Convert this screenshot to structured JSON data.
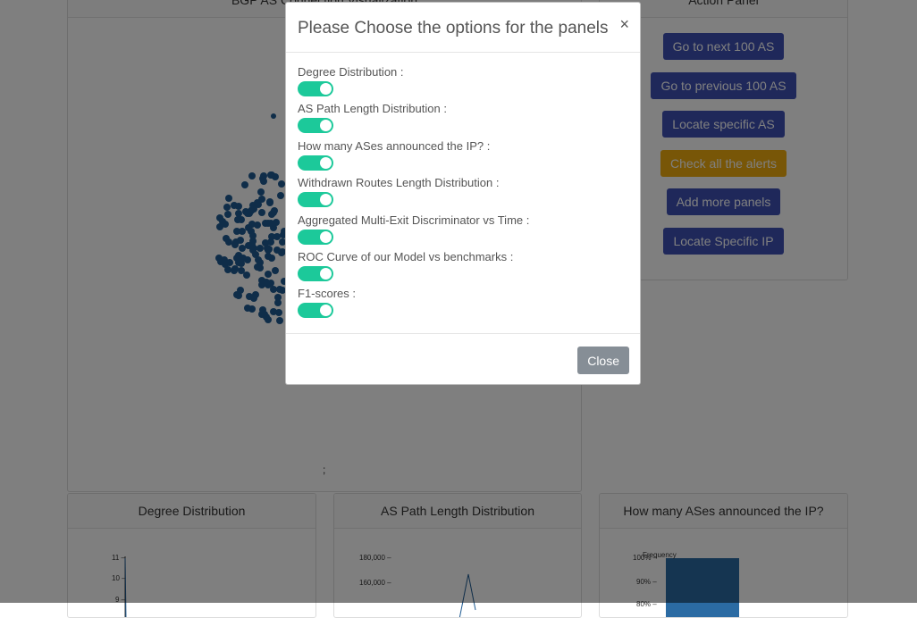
{
  "top_panel": {
    "title": "BGP AS Connection Visualization",
    "footnote": ";"
  },
  "action_panel": {
    "title": "Action Panel",
    "buttons": [
      {
        "label": "Go to next 100 AS"
      },
      {
        "label": "Go to previous 100 AS"
      },
      {
        "label": "Locate specific AS"
      },
      {
        "label": "Check all the alerts"
      },
      {
        "label": "Add more panels"
      },
      {
        "label": "Locate Specific IP"
      }
    ]
  },
  "bottom_panels": {
    "degree": {
      "title": "Degree Distribution",
      "y_ticks": [
        "11 –",
        "10 –",
        "9 –"
      ]
    },
    "path_length": {
      "title": "AS Path Length Distribution",
      "y_ticks": [
        "180,000 –",
        "160,000 –"
      ]
    },
    "announced": {
      "title": "How many ASes announced the IP?",
      "legend": "Frequency",
      "y_ticks": [
        "100% –",
        "90% –",
        "80% –"
      ]
    }
  },
  "modal": {
    "title": "Please Choose the options for the panels",
    "close_symbol": "×",
    "options": [
      {
        "label": "Degree Distribution :",
        "enabled": true
      },
      {
        "label": "AS Path Length Distribution :",
        "enabled": true
      },
      {
        "label": "How many ASes announced the IP? :",
        "enabled": true
      },
      {
        "label": "Withdrawn Routes Length Distribution :",
        "enabled": true
      },
      {
        "label": "Aggregated Multi-Exit Discriminator vs Time :",
        "enabled": true
      },
      {
        "label": "ROC Curve of our Model vs benchmarks :",
        "enabled": true
      },
      {
        "label": "F1-scores :",
        "enabled": true
      }
    ],
    "close_button": "Close"
  },
  "colors": {
    "primary": "#3f51b5",
    "warning": "#f0ad0e",
    "toggle_on": "#1cc99a",
    "node": "#1f5b92"
  }
}
